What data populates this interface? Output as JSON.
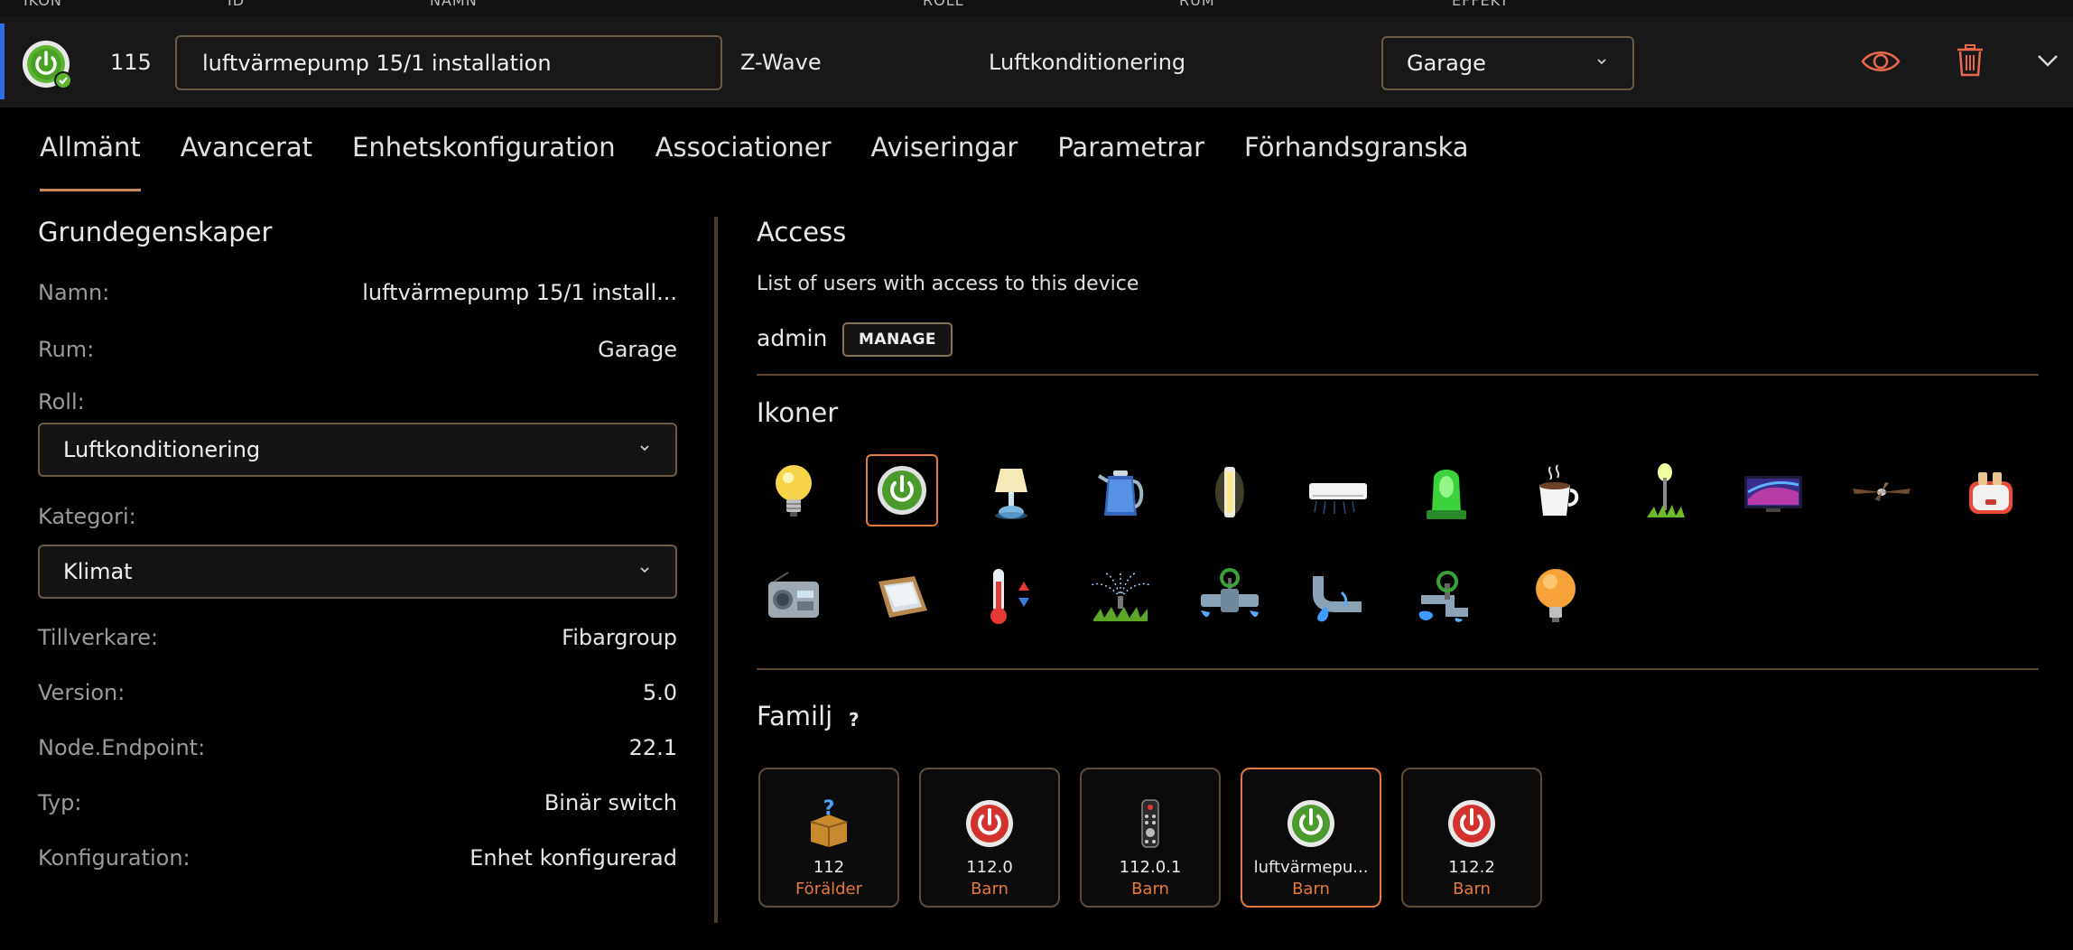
{
  "columns": {
    "icon": "IKON",
    "id": "ID",
    "name": "NAMN",
    "role": "ROLL",
    "room": "RUM",
    "effect": "EFFEKT"
  },
  "device": {
    "id": "115",
    "name": "luftvärmepump 15/1 installation",
    "protocol": "Z-Wave",
    "role": "Luftkonditionering",
    "room": "Garage",
    "icon": "power-button-green-icon"
  },
  "tabs": [
    "Allmänt",
    "Avancerat",
    "Enhetskonfiguration",
    "Associationer",
    "Aviseringar",
    "Parametrar",
    "Förhandsgranska"
  ],
  "active_tab": "Allmänt",
  "general": {
    "title": "Grundegenskaper",
    "name_label": "Namn:",
    "name_value": "luftvärmepump 15/1 install...",
    "room_label": "Rum:",
    "room_value": "Garage",
    "role_label": "Roll:",
    "role_value": "Luftkonditionering",
    "category_label": "Kategori:",
    "category_value": "Klimat",
    "manufacturer_label": "Tillverkare:",
    "manufacturer_value": "Fibargroup",
    "version_label": "Version:",
    "version_value": "5.0",
    "endpoint_label": "Node.Endpoint:",
    "endpoint_value": "22.1",
    "type_label": "Typ:",
    "type_value": "Binär switch",
    "config_label": "Konfiguration:",
    "config_value": "Enhet konfigurerad"
  },
  "access": {
    "title": "Access",
    "subtitle": "List of users with access to this device",
    "user": "admin",
    "manage_label": "MANAGE"
  },
  "icons": {
    "title": "Ikoner",
    "items": [
      "light-bulb-icon",
      "power-button-icon",
      "table-lamp-icon",
      "kettle-icon",
      "wall-light-icon",
      "air-conditioner-icon",
      "alarm-beacon-icon",
      "coffee-cup-icon",
      "garden-lamp-icon",
      "tv-icon",
      "ceiling-fan-icon",
      "toaster-icon",
      "radio-icon",
      "roof-window-icon",
      "thermostat-icon",
      "sprinkler-icon",
      "valve-icon",
      "water-pipe-icon",
      "water-valve-icon",
      "orange-bulb-icon"
    ],
    "selected": "power-button-icon"
  },
  "family": {
    "title": "Familj",
    "help": "?",
    "members": [
      {
        "id": "112",
        "role": "Förälder",
        "icon": "unknown-box-icon"
      },
      {
        "id": "112.0",
        "role": "Barn",
        "icon": "power-button-red-icon"
      },
      {
        "id": "112.0.1",
        "role": "Barn",
        "icon": "remote-control-icon"
      },
      {
        "id": "luftvärmepu...",
        "role": "Barn",
        "icon": "power-button-green-icon"
      },
      {
        "id": "112.2",
        "role": "Barn",
        "icon": "power-button-red-icon"
      }
    ]
  },
  "colors": {
    "accent": "#e57a3d",
    "border": "#6b5a45",
    "selected_tab_underline": "#c98b57",
    "row_marker": "#2e6de6"
  }
}
